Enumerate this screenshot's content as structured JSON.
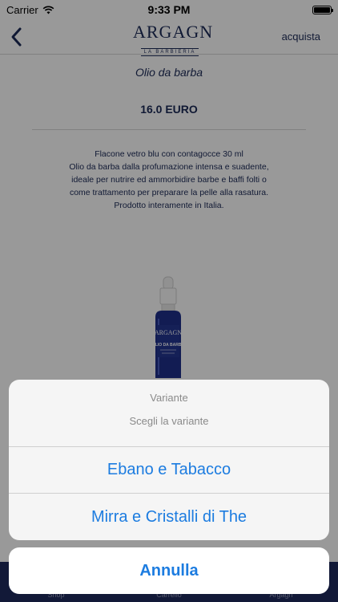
{
  "status_bar": {
    "carrier": "Carrier",
    "time": "9:33 PM"
  },
  "nav": {
    "logo_text": "ARGAGN",
    "logo_sub": "LA BARBIERIA",
    "right_action": "acquista"
  },
  "product": {
    "name": "Olio da barba",
    "price": "16.0 EURO",
    "description": [
      "Flacone vetro blu con contagocce  30 ml",
      "Olio da barba dalla profumazione intensa e suadente,",
      "ideale per nutrire ed ammorbidire barbe e baffi folti o",
      "come trattamento per preparare la pelle alla rasatura.",
      "Prodotto interamente in Italia."
    ],
    "bottle_label": {
      "brand": "ARGAGN",
      "line1": "OLIO DA BARBA"
    }
  },
  "tab_bar": {
    "tabs": [
      {
        "label": "Shop"
      },
      {
        "label": "Carrello"
      },
      {
        "label": "Argagn"
      }
    ]
  },
  "action_sheet": {
    "title": "Variante",
    "message": "Scegli la variante",
    "options": [
      "Ebano e Tabacco",
      "Mirra e Cristalli di The"
    ],
    "cancel": "Annulla"
  },
  "colors": {
    "brand_navy": "#1c2a57",
    "ios_blue": "#1c7ce0",
    "tab_bar_bg": "#1f2a5e"
  }
}
